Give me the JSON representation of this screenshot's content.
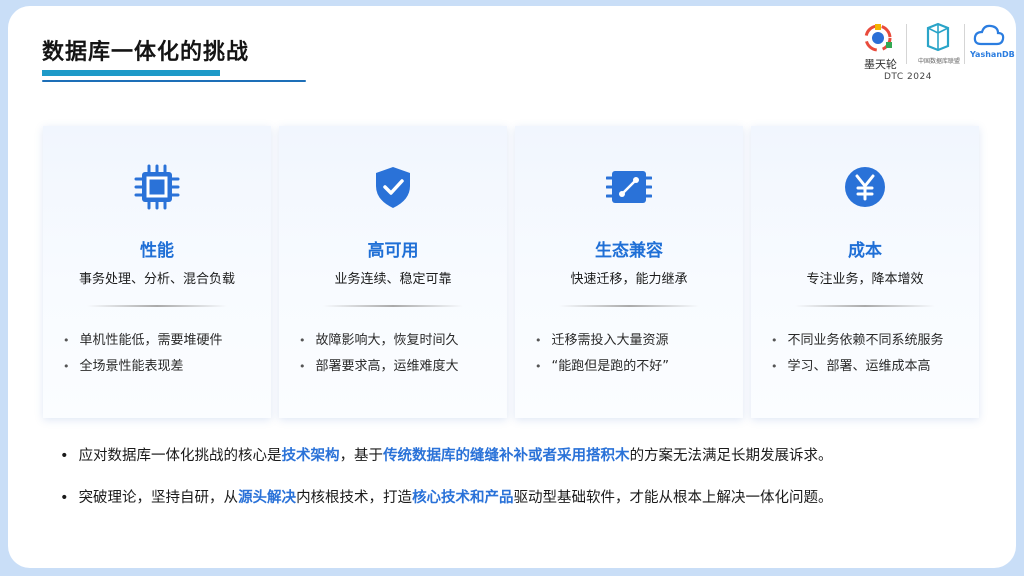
{
  "title": "数据库一体化的挑战",
  "logos": {
    "left_label": "墨天轮",
    "mid_label": "中国数据库联盟",
    "right_label": "YashanDB",
    "event": "DTC 2024"
  },
  "cards": [
    {
      "icon": "chip-icon",
      "title": "性能",
      "subtitle": "事务处理、分析、混合负载",
      "bullets": [
        "单机性能低，需要堆硬件",
        "全场景性能表现差"
      ]
    },
    {
      "icon": "shield-check-icon",
      "title": "高可用",
      "subtitle": "业务连续、稳定可靠",
      "bullets": [
        "故障影响大，恢复时间久",
        "部署要求高，运维难度大"
      ]
    },
    {
      "icon": "migration-board-icon",
      "title": "生态兼容",
      "subtitle": "快速迁移，能力继承",
      "bullets": [
        "迁移需投入大量资源",
        "“能跑但是跑的不好”"
      ]
    },
    {
      "icon": "yen-icon",
      "title": "成本",
      "subtitle": "专注业务，降本增效",
      "bullets": [
        "不同业务依赖不同系统服务",
        "学习、部署、运维成本高"
      ]
    }
  ],
  "bottom": {
    "line1": [
      "应对数据库一体化挑战的核心是",
      "技术架构",
      "，基于",
      "传统数据库的缝缝补补或者采用搭积木",
      "的方案无法满足长期发展诉求。"
    ],
    "line2": [
      "突破理论，坚持自研，从",
      "源头解决",
      "内核根技术，打造",
      "核心技术和产品",
      "驱动型基础软件，才能从根本上解决一体化问题。"
    ]
  },
  "colors": {
    "accent": "#1f6fd6",
    "title_bar": "#1e9ac8",
    "frame": "#c9def7"
  }
}
